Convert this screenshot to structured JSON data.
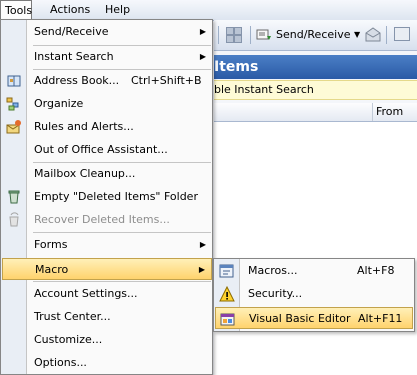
{
  "menubar": {
    "tools": "Tools",
    "actions": "Actions",
    "help": "Help"
  },
  "toolbar": {
    "send_receive": "Send/Receive"
  },
  "pane": {
    "title": "Items",
    "search_hint": "ble Instant Search",
    "col_from": "From"
  },
  "tools_menu": {
    "items": [
      {
        "label": "Send/Receive",
        "has_submenu": true
      },
      {
        "label": "Instant Search",
        "has_submenu": true
      },
      {
        "label": "Address Book...",
        "shortcut": "Ctrl+Shift+B",
        "icon": "address-book-icon"
      },
      {
        "label": "Organize",
        "icon": "organize-icon"
      },
      {
        "label": "Rules and Alerts...",
        "icon": "rules-alerts-icon"
      },
      {
        "label": "Out of Office Assistant..."
      },
      {
        "label": "Mailbox Cleanup..."
      },
      {
        "label": "Empty \"Deleted Items\" Folder",
        "icon": "empty-deleted-icon"
      },
      {
        "label": "Recover Deleted Items...",
        "icon": "recover-deleted-icon",
        "disabled": true
      },
      {
        "label": "Forms",
        "has_submenu": true
      },
      {
        "label": "Macro",
        "has_submenu": true,
        "highlighted": true
      },
      {
        "label": "Account Settings..."
      },
      {
        "label": "Trust Center..."
      },
      {
        "label": "Customize..."
      },
      {
        "label": "Options..."
      }
    ]
  },
  "macro_submenu": {
    "items": [
      {
        "label": "Macros...",
        "shortcut": "Alt+F8",
        "icon": "macros-icon"
      },
      {
        "label": "Security...",
        "icon": "security-warning-icon"
      },
      {
        "label": "Visual Basic Editor",
        "shortcut": "Alt+F11",
        "icon": "vb-editor-icon",
        "highlighted": true
      }
    ]
  }
}
